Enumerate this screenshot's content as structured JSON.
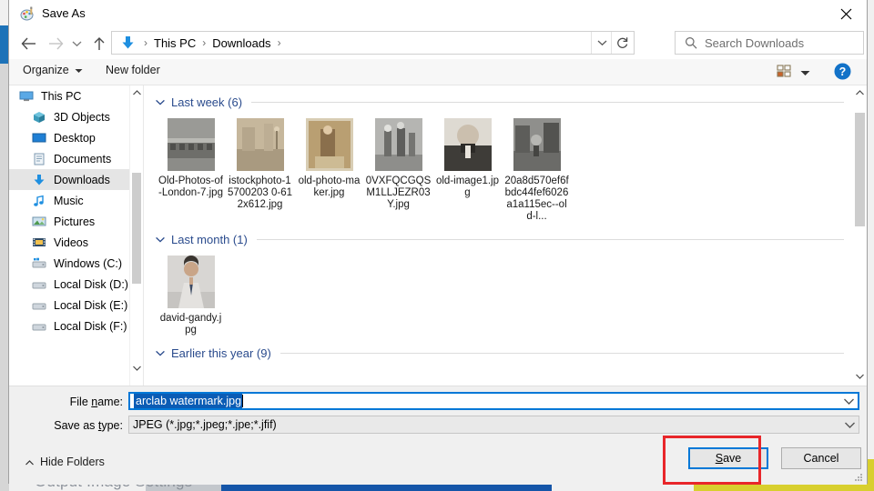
{
  "background_app": {
    "heading": "Output Image Settings"
  },
  "dialog": {
    "title": "Save As",
    "app_icon": "paint-palette-icon",
    "close_label": "Close"
  },
  "navigation": {
    "back": "Back",
    "forward": "Forward",
    "recent": "Recent locations",
    "up": "Up",
    "breadcrumb": {
      "icon": "downloads-arrow-icon",
      "items": [
        "This PC",
        "Downloads"
      ],
      "separator": "›"
    },
    "dropdown": "Previous locations",
    "refresh": "Refresh"
  },
  "search": {
    "placeholder": "Search Downloads",
    "icon": "search-icon"
  },
  "commandbar": {
    "organize": "Organize",
    "new_folder": "New folder",
    "view_icon": "view-layout-icon",
    "view_dropdown": "chevron-down-icon",
    "help": "?"
  },
  "sidebar": {
    "items": [
      {
        "label": "This PC",
        "icon": "monitor-icon",
        "selected": false,
        "indent": 0
      },
      {
        "label": "3D Objects",
        "icon": "cube-icon",
        "selected": false,
        "indent": 1
      },
      {
        "label": "Desktop",
        "icon": "desktop-icon",
        "selected": false,
        "indent": 1
      },
      {
        "label": "Documents",
        "icon": "document-icon",
        "selected": false,
        "indent": 1
      },
      {
        "label": "Downloads",
        "icon": "downloads-arrow-icon",
        "selected": true,
        "indent": 1
      },
      {
        "label": "Music",
        "icon": "music-note-icon",
        "selected": false,
        "indent": 1
      },
      {
        "label": "Pictures",
        "icon": "picture-icon",
        "selected": false,
        "indent": 1
      },
      {
        "label": "Videos",
        "icon": "video-icon",
        "selected": false,
        "indent": 1
      },
      {
        "label": "Windows (C:)",
        "icon": "windows-drive-icon",
        "selected": false,
        "indent": 1
      },
      {
        "label": "Local Disk (D:)",
        "icon": "drive-icon",
        "selected": false,
        "indent": 1
      },
      {
        "label": "Local Disk (E:)",
        "icon": "drive-icon",
        "selected": false,
        "indent": 1
      },
      {
        "label": "Local Disk (F:)",
        "icon": "drive-icon",
        "selected": false,
        "indent": 1
      }
    ]
  },
  "file_list": {
    "groups": [
      {
        "label": "Last week (6)",
        "count": 6,
        "files": [
          {
            "name": "Old-Photos-of-London-7.jpg",
            "thumb": "c1"
          },
          {
            "name": "istockphoto-15700203 0-612x612.jpg",
            "thumb": "c2"
          },
          {
            "name": "old-photo-maker.jpg",
            "thumb": "c3"
          },
          {
            "name": "0VXFQCGQSM1LLJEZR03Y.jpg",
            "thumb": "c4"
          },
          {
            "name": "old-image1.jpg",
            "thumb": "c5"
          },
          {
            "name": "20a8d570ef6fbdc44fef6026a1a115ec--old-l...",
            "thumb": "c6"
          }
        ]
      },
      {
        "label": "Last month (1)",
        "count": 1,
        "files": [
          {
            "name": "david-gandy.jpg",
            "thumb": "c7"
          }
        ]
      },
      {
        "label": "Earlier this year (9)",
        "count": 9,
        "files": []
      }
    ]
  },
  "form": {
    "filename_label": "File name:",
    "filename_value": "arclab watermark.jpg",
    "filename_selected": true,
    "savetype_label": "Save as type:",
    "savetype_value": "JPEG (*.jpg;*.jpeg;*.jpe;*.jfif)"
  },
  "footer": {
    "hide_folders": "Hide Folders",
    "save_label": "Save",
    "cancel_label": "Cancel"
  },
  "annotation": {
    "color": "#e8262a",
    "target": "save-button"
  },
  "colors": {
    "accent": "#0078d7",
    "selection": "#0b5cb5",
    "group_header": "#2a4b8d",
    "annotation": "#e8262a"
  }
}
